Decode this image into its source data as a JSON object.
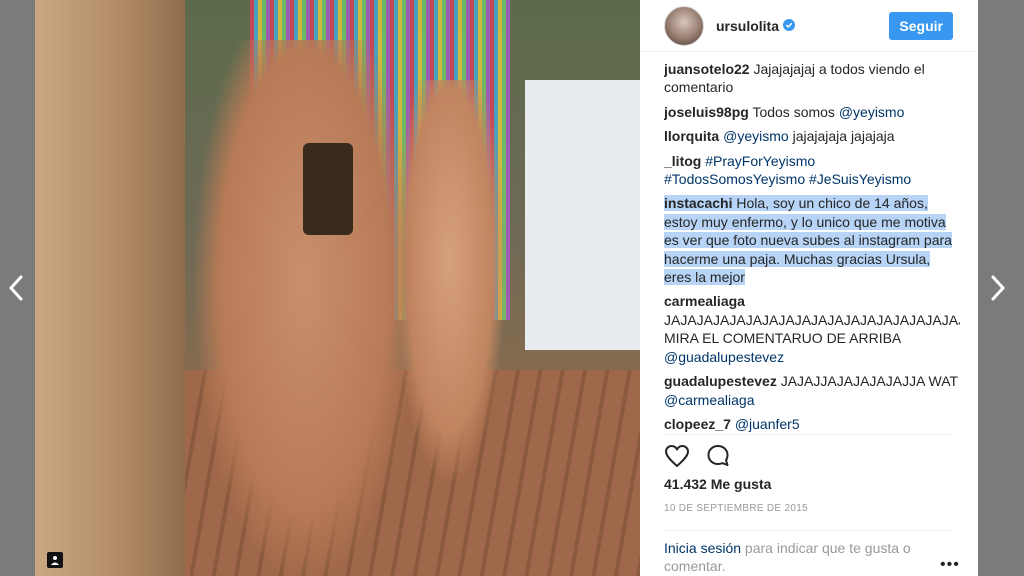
{
  "profile": {
    "username": "ursulolita",
    "verified": true,
    "follow_label": "Seguir"
  },
  "comments": [
    {
      "user": "juansotelo22",
      "text": " Jajajajajaj a todos viendo el comentario"
    },
    {
      "user": "joseluis98pg",
      "text": " Todos somos ",
      "link": "@yeyismo"
    },
    {
      "user": "llorquita",
      "link": "@yeyismo",
      "text": " jajajajaja jajajaja"
    },
    {
      "user": "_litog",
      "link": "#PrayForYeyismo #TodosSomosYeyismo #JeSuisYeyismo"
    },
    {
      "user": "instacachi",
      "text": " Hola, soy un chico de 14 años, estoy muy enfermo, y lo unico que me motiva es ver que foto nueva subes al instagram para hacerme una paja. Muchas gracias Ursula, eres la mejor"
    },
    {
      "user": "carmealiaga",
      "text": " JAJAJAJAJAJAJAJAJAJAJAJAJAJAJAJAJAJAJA MIRA EL COMENTARUO DE ARRIBA ",
      "link": "@guadalupestevez"
    },
    {
      "user": "guadalupestevez",
      "text": " JAJAJJAJAJAJAJAJJA WAT ",
      "link": "@carmealiaga"
    },
    {
      "user": "clopeez_7",
      "link": "@juanfer5"
    }
  ],
  "actions": {
    "like_icon": "heart-icon",
    "comment_icon": "comment-icon"
  },
  "likes_text": "41.432 Me gusta",
  "date_text": "10 DE SEPTIEMBRE DE 2015",
  "login": {
    "link_label": "Inicia sesión",
    "text": " para indicar que te gusta o comentar."
  },
  "colors": {
    "follow_button": "#3897f0",
    "link": "#003569",
    "highlight": "#b7d4f6",
    "backdrop": "#7b7b7b"
  }
}
